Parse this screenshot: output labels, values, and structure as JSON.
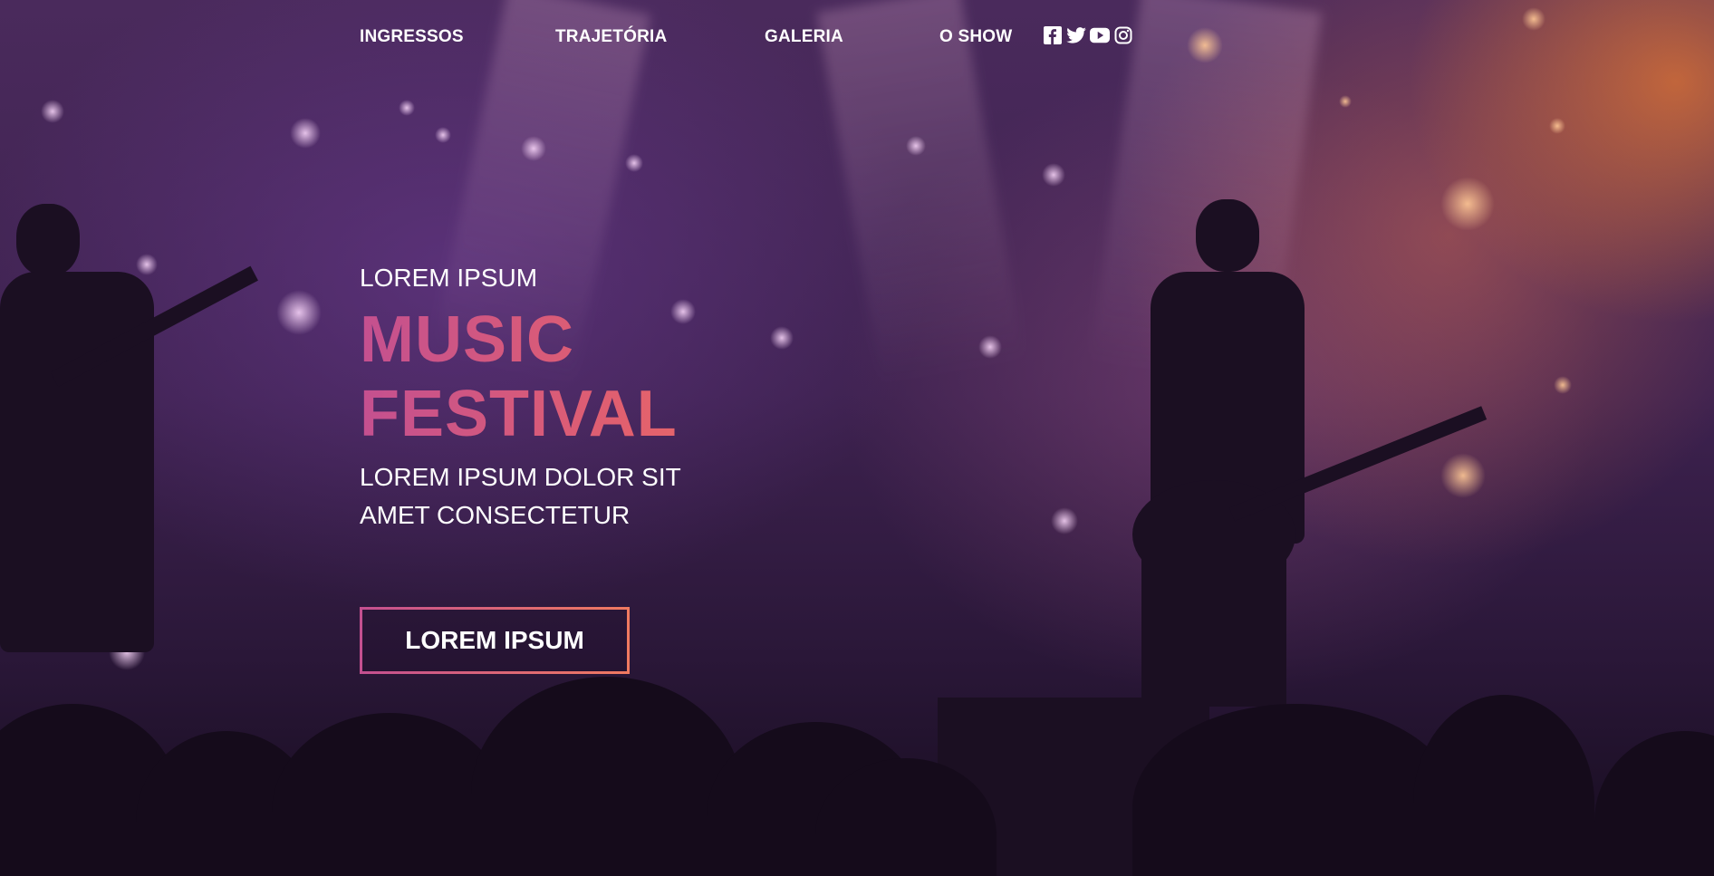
{
  "nav": {
    "items": [
      {
        "label": "INGRESSOS"
      },
      {
        "label": "TRAJETÓRIA"
      },
      {
        "label": "GALERIA"
      },
      {
        "label": "O SHOW"
      }
    ],
    "social": [
      "facebook-icon",
      "twitter-icon",
      "youtube-icon",
      "instagram-icon"
    ]
  },
  "hero": {
    "kicker": "LOREM IPSUM",
    "title_line1": "MUSIC",
    "title_line2": "FESTIVAL",
    "subtitle_line1": "LOREM IPSUM DOLOR SIT",
    "subtitle_line2": "AMET CONSECTETUR",
    "cta_label": "LOREM IPSUM"
  },
  "colors": {
    "gradient_start": "#c45090",
    "gradient_end": "#f07a60",
    "text": "#ffffff"
  }
}
